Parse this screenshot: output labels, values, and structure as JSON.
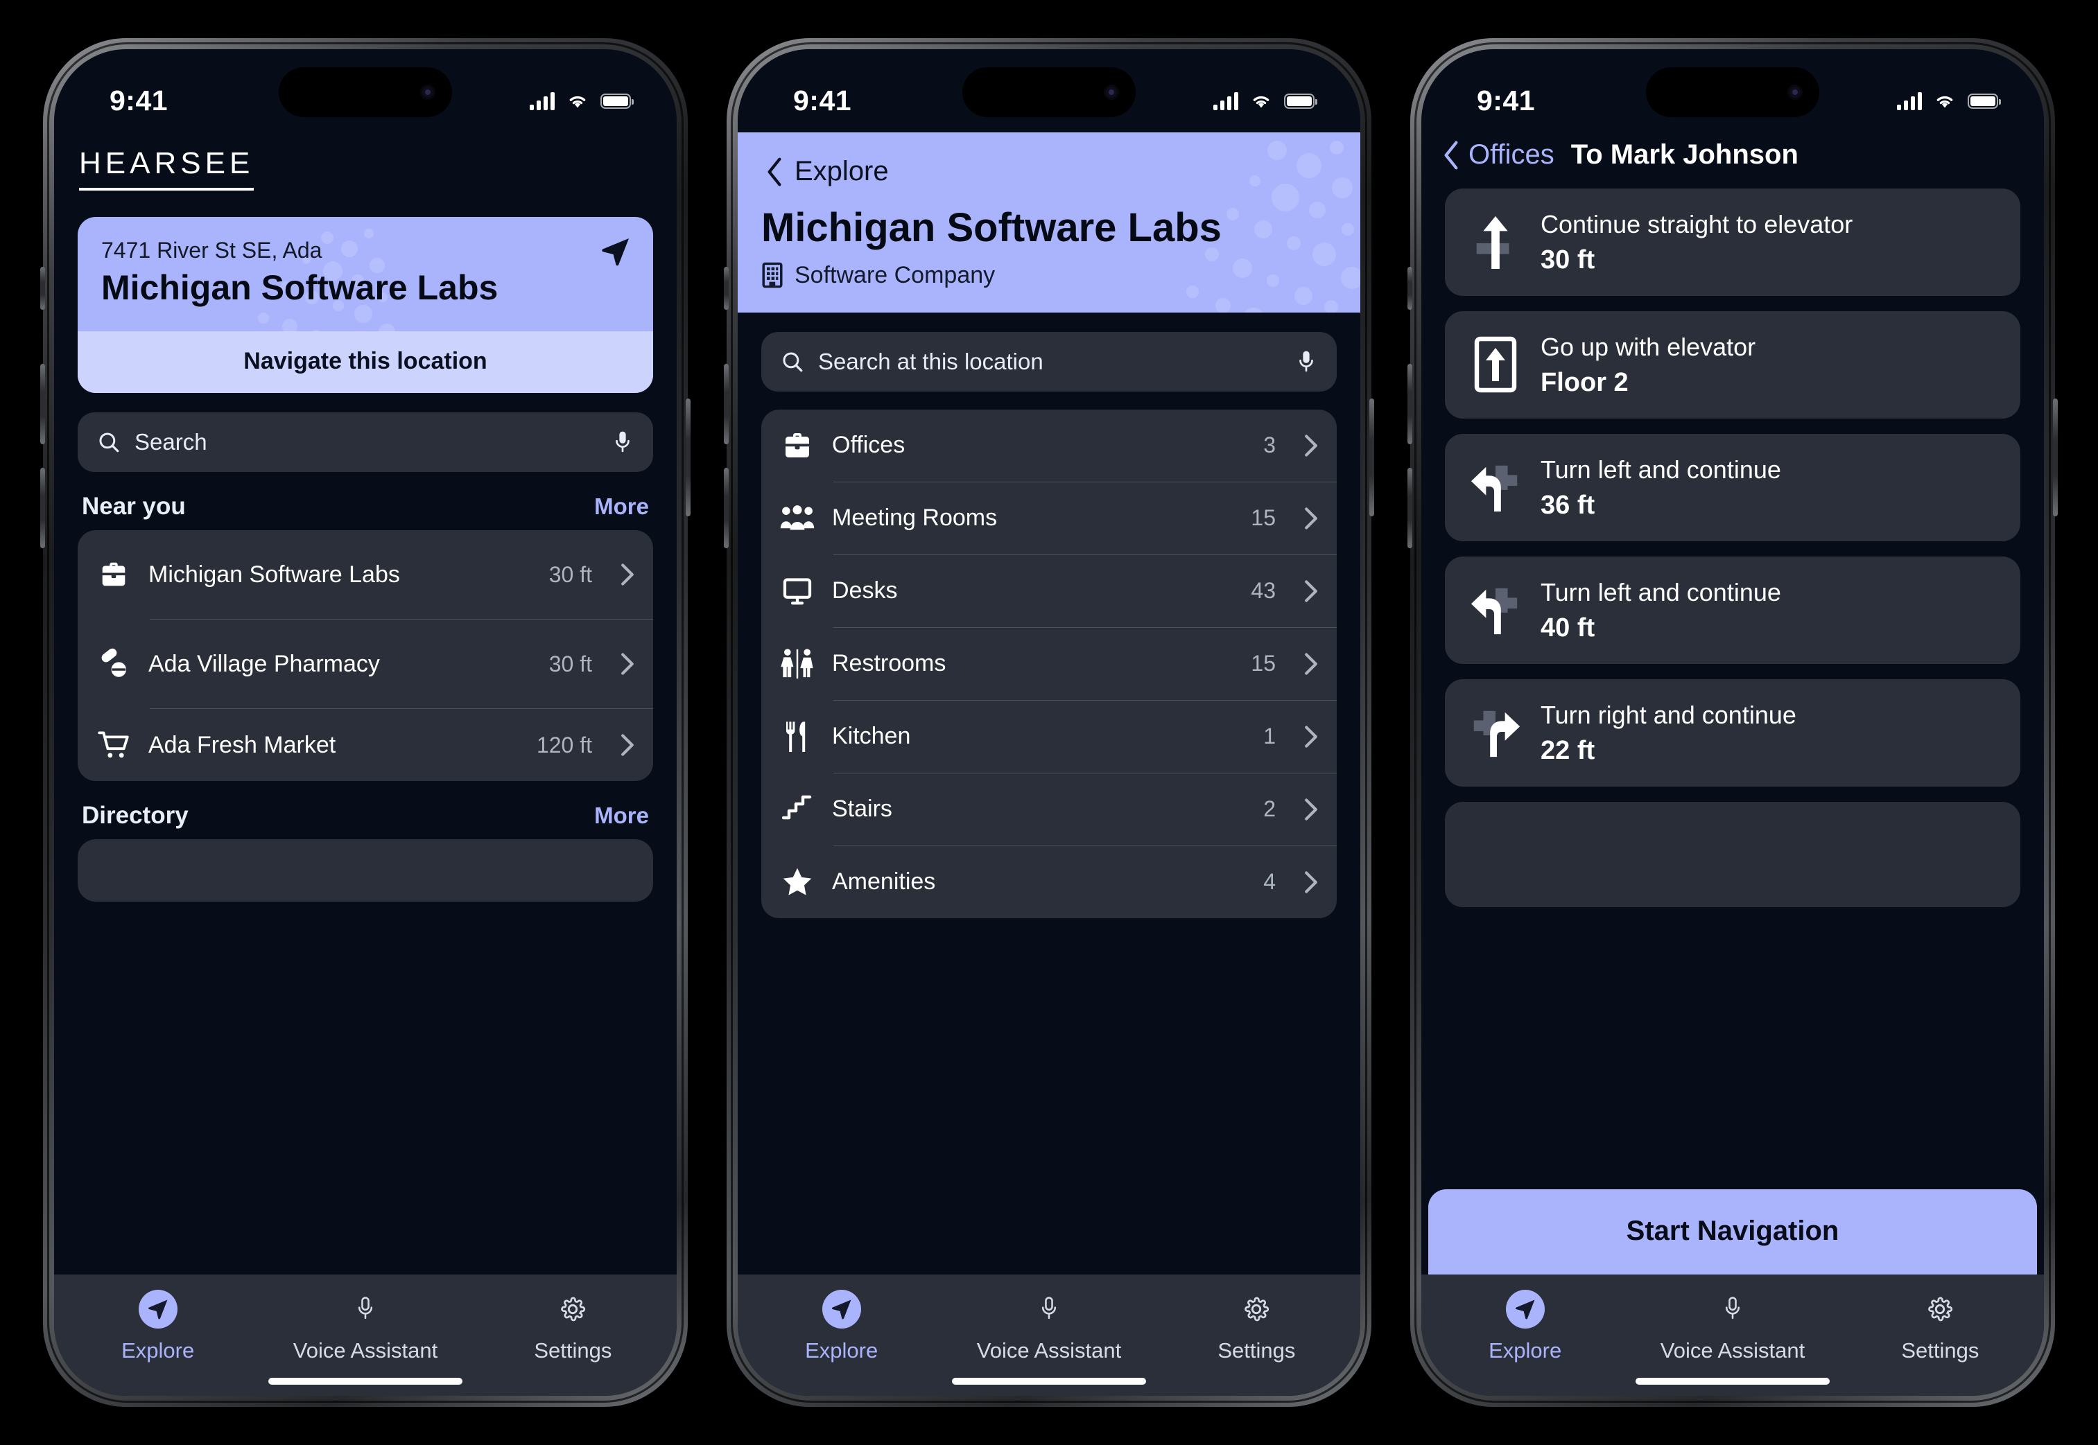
{
  "colors": {
    "accent": "#aab4fc",
    "accent_light": "#ccd3fd",
    "screen_bg": "#060d18",
    "card_bg": "#2a2f39",
    "text_primary": "#ffffff",
    "text_muted": "#aeb5c0"
  },
  "status_bar": {
    "time": "9:41"
  },
  "tabs": [
    {
      "label": "Explore",
      "icon": "navigation-arrow-icon",
      "active": true
    },
    {
      "label": "Voice Assistant",
      "icon": "microphone-icon",
      "active": false
    },
    {
      "label": "Settings",
      "icon": "gear-icon",
      "active": false
    }
  ],
  "phone1": {
    "brand": "HEARSEE",
    "hero": {
      "address": "7471 River St SE, Ada",
      "name": "Michigan Software Labs",
      "button_label": "Navigate this location",
      "nav_icon": "navigation-arrow-icon"
    },
    "search": {
      "placeholder": "Search",
      "icon": "search-icon",
      "mic_icon": "microphone-icon"
    },
    "near_you": {
      "title": "Near you",
      "more_label": "More",
      "items": [
        {
          "name": "Michigan Software Labs",
          "distance": "30 ft",
          "icon": "briefcase-icon"
        },
        {
          "name": "Ada Village Pharmacy",
          "distance": "30 ft",
          "icon": "pills-icon"
        },
        {
          "name": "Ada Fresh Market",
          "distance": "120 ft",
          "icon": "shopping-cart-icon"
        }
      ]
    },
    "directory": {
      "title": "Directory",
      "more_label": "More"
    }
  },
  "phone2": {
    "back_label": "Explore",
    "title": "Michigan Software Labs",
    "subtitle": "Software Company",
    "subtitle_icon": "building-icon",
    "search": {
      "placeholder": "Search at this location",
      "icon": "search-icon",
      "mic_icon": "microphone-icon"
    },
    "categories": [
      {
        "label": "Offices",
        "count": "3",
        "icon": "briefcase-icon"
      },
      {
        "label": "Meeting Rooms",
        "count": "15",
        "icon": "people-group-icon"
      },
      {
        "label": "Desks",
        "count": "43",
        "icon": "monitor-icon"
      },
      {
        "label": "Restrooms",
        "count": "15",
        "icon": "restroom-icon"
      },
      {
        "label": "Kitchen",
        "count": "1",
        "icon": "utensils-icon"
      },
      {
        "label": "Stairs",
        "count": "2",
        "icon": "stairs-icon"
      },
      {
        "label": "Amenities",
        "count": "4",
        "icon": "star-icon"
      }
    ]
  },
  "phone3": {
    "back_label": "Offices",
    "title": "To Mark Johnson",
    "cta_label": "Start Navigation",
    "steps": [
      {
        "instruction": "Continue straight to elevator",
        "detail": "30 ft",
        "icon": "arrow-straight-icon"
      },
      {
        "instruction": "Go up with elevator",
        "detail": "Floor 2",
        "icon": "elevator-up-icon"
      },
      {
        "instruction": "Turn left and continue",
        "detail": "36 ft",
        "icon": "turn-left-icon"
      },
      {
        "instruction": "Turn left and continue",
        "detail": "40 ft",
        "icon": "turn-left-icon"
      },
      {
        "instruction": "Turn right and continue",
        "detail": "22 ft",
        "icon": "turn-right-icon"
      }
    ]
  }
}
